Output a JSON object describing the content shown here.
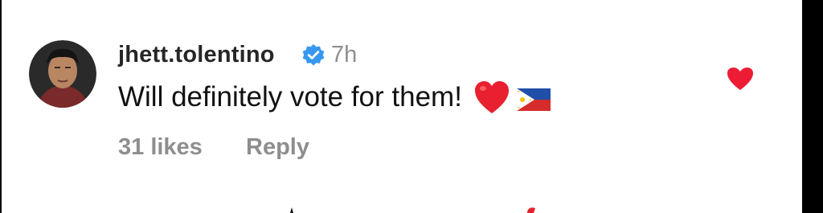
{
  "comment": {
    "username": "jhett.tolentino",
    "timestamp": "7h",
    "text": "Will definitely vote for them!",
    "likes": "31 likes",
    "reply_label": "Reply",
    "liked": true
  },
  "icons": {
    "verified": "verified-badge-icon",
    "emoji_heart": "red-heart-emoji",
    "emoji_flag": "philippines-flag-emoji",
    "like": "heart-icon"
  },
  "colors": {
    "verified_blue": "#3897f0",
    "like_red": "#ed1c34",
    "muted_text": "#8e8e8e"
  }
}
